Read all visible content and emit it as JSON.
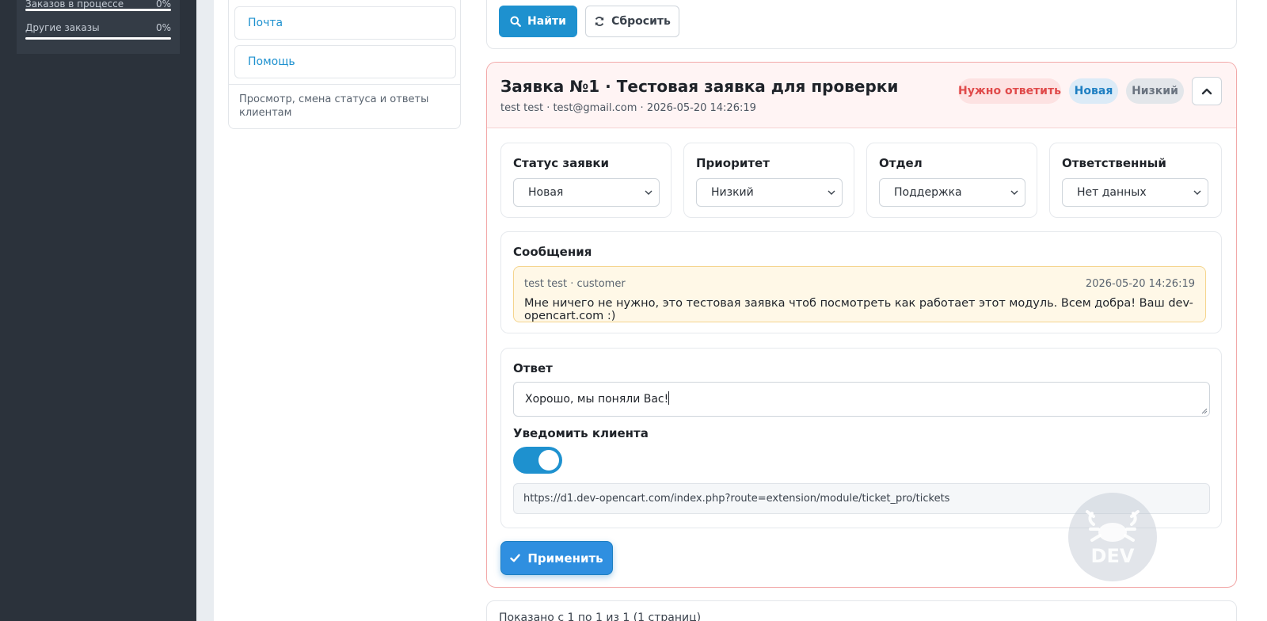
{
  "sidebar": {
    "stats": [
      {
        "label": "Заказов в процессе",
        "percent_text": "0%",
        "progress": 0
      },
      {
        "label": "Другие заказы",
        "percent_text": "0%",
        "progress": 0
      }
    ]
  },
  "menu": {
    "items": [
      {
        "label": "Почта"
      },
      {
        "label": "Помощь"
      }
    ],
    "description": "Просмотр, смена статуса и ответы клиентам"
  },
  "search": {
    "find_label": "Найти",
    "reset_label": "Сбросить"
  },
  "ticket": {
    "title": "Заявка №1 · Тестовая заявка для проверки",
    "meta": "test test · test@gmail.com · 2026-05-20 14:26:19",
    "badges": {
      "need_reply": "Нужно ответить",
      "status": "Новая",
      "priority": "Низкий"
    },
    "fields": [
      {
        "label": "Статус заявки",
        "value": "Новая"
      },
      {
        "label": "Приоритет",
        "value": "Низкий"
      },
      {
        "label": "Отдел",
        "value": "Поддержка"
      },
      {
        "label": "Ответственный",
        "value": "Нет данных"
      }
    ],
    "messages": {
      "title": "Сообщения",
      "items": [
        {
          "author": "test test · customer",
          "date": "2026-05-20 14:26:19",
          "text": "Мне ничего не нужно, это тестовая заявка чтоб посмотреть как работает этот модуль. Всем добра! Ваш dev-opencart.com :)"
        }
      ]
    },
    "reply": {
      "title": "Ответ",
      "value": "Хорошо, мы поняли Вас!",
      "notify_label": "Уведомить клиента",
      "notify_on": true,
      "url": "https://d1.dev-opencart.com/index.php?route=extension/module/ticket_pro/tickets"
    },
    "apply_label": "Применить"
  },
  "watermark": {
    "text": "DEV"
  },
  "pagination": {
    "text": "Показано с 1 по 1 из 1 (1 страниц)"
  },
  "colors": {
    "accent": "#1e91cf",
    "sidebar_bg": "#2b323b",
    "need_reply": "#e04a4a",
    "message_bg": "#fff8e7"
  }
}
